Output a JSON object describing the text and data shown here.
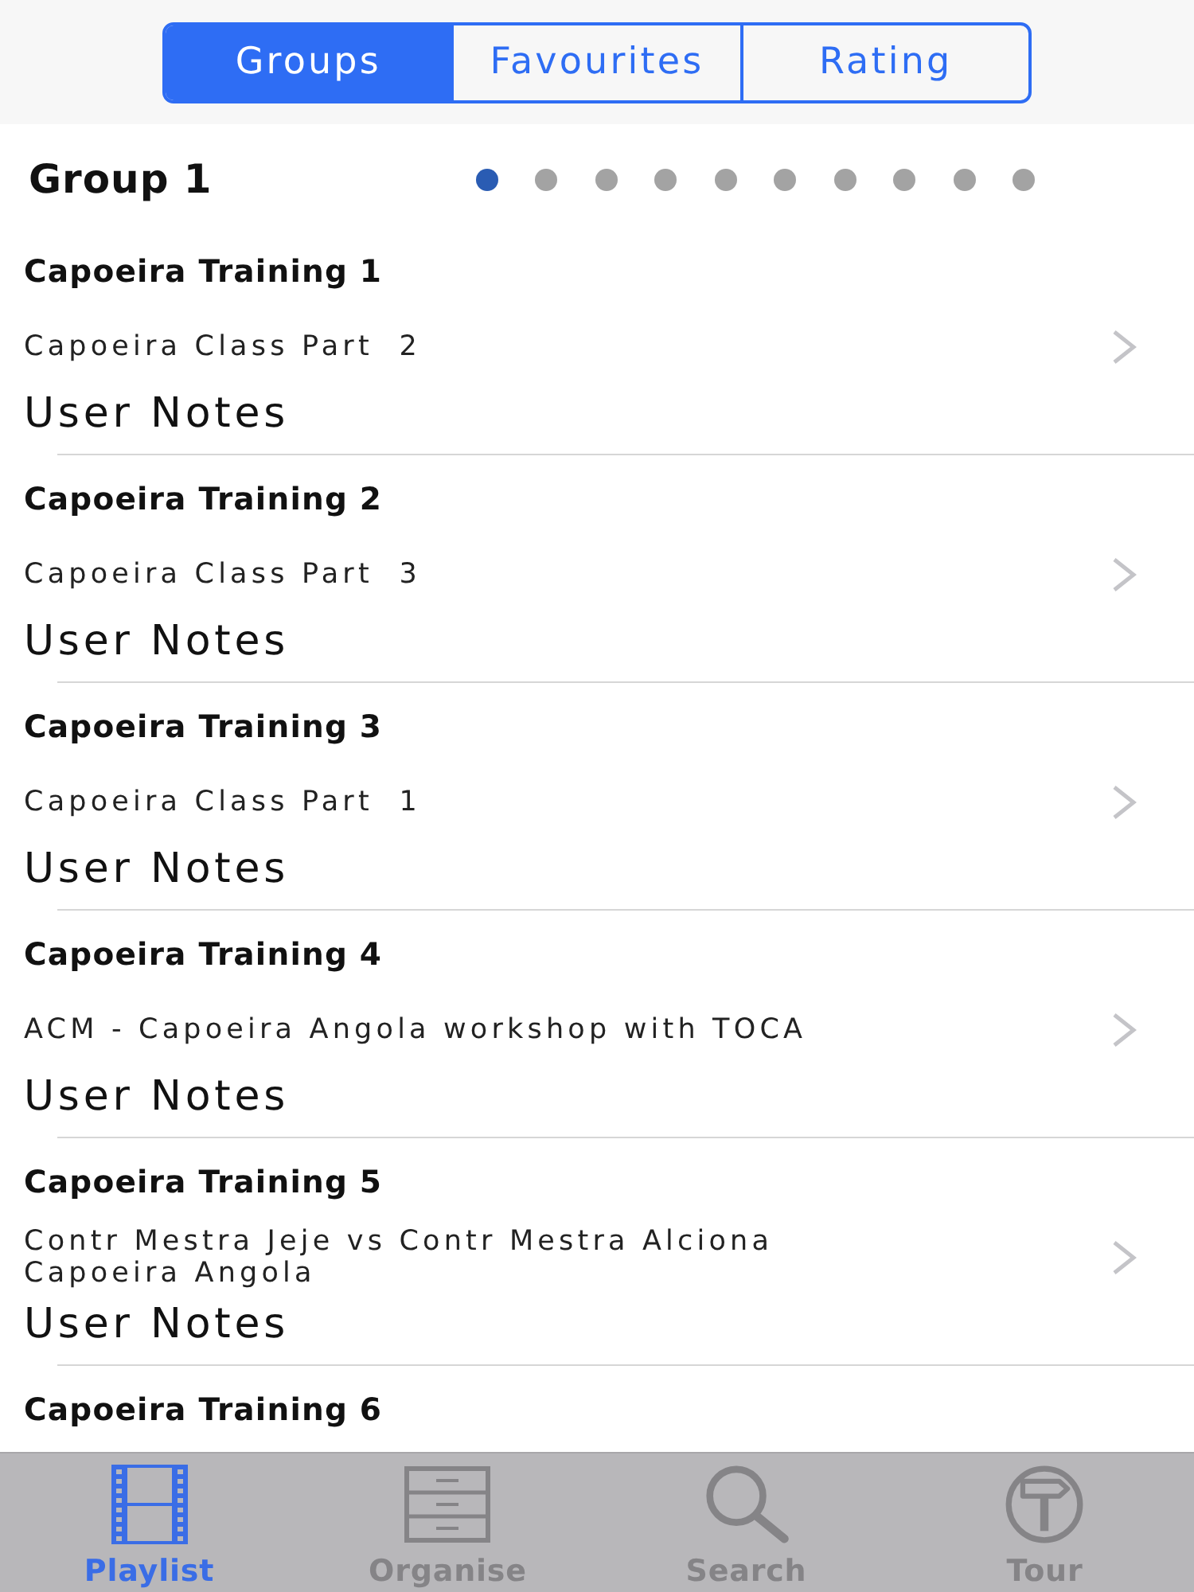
{
  "segments": [
    {
      "label": "Groups",
      "selected": true
    },
    {
      "label": "Favourites",
      "selected": false
    },
    {
      "label": "Rating",
      "selected": false
    }
  ],
  "group": {
    "title": "Group 1",
    "pages": [
      {
        "selected": true
      },
      {
        "selected": false
      },
      {
        "selected": false
      },
      {
        "selected": false
      },
      {
        "selected": false
      },
      {
        "selected": false
      },
      {
        "selected": false
      },
      {
        "selected": false
      },
      {
        "selected": false
      },
      {
        "selected": false
      }
    ]
  },
  "rows": [
    {
      "title": "Capoeira Training 1",
      "subtitle": "Capoeira Class Part  2",
      "notes": "User Notes"
    },
    {
      "title": "Capoeira Training 2",
      "subtitle": "Capoeira Class Part  3",
      "notes": "User Notes"
    },
    {
      "title": "Capoeira Training 3",
      "subtitle": "Capoeira Class Part  1",
      "notes": "User Notes"
    },
    {
      "title": "Capoeira Training 4",
      "subtitle": "ACM - Capoeira Angola workshop with TOCA",
      "notes": "User Notes"
    },
    {
      "title": "Capoeira Training 5",
      "subtitle": "Contr Mestra Jeje vs Contr Mestra Alciona Capoeira Angola",
      "notes": "User Notes"
    },
    {
      "title": "Capoeira Training 6"
    }
  ],
  "tab_bar": [
    {
      "label": "Playlist",
      "selected": true
    },
    {
      "label": "Organise",
      "selected": false
    },
    {
      "label": "Search",
      "selected": false
    },
    {
      "label": "Tour",
      "selected": false
    }
  ]
}
